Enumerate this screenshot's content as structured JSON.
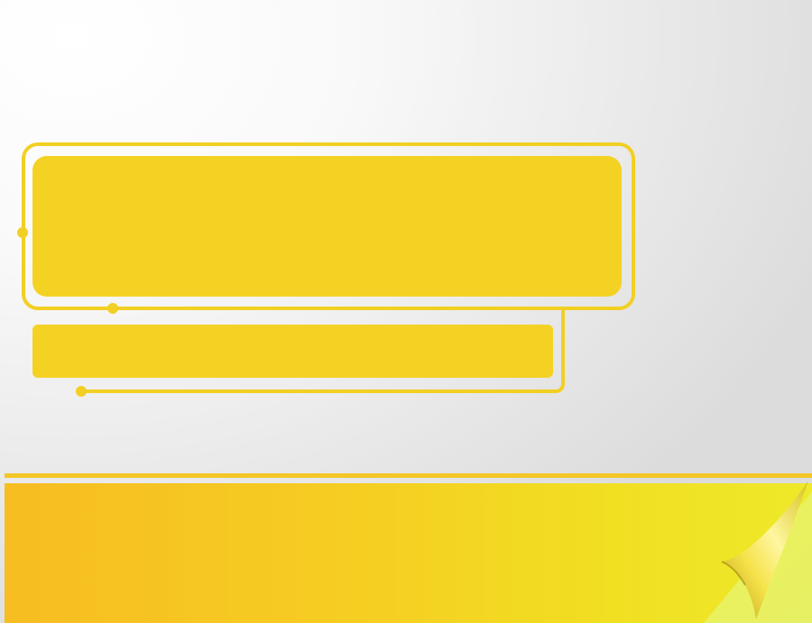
{
  "slide": {
    "title": "",
    "subtitle": "",
    "footer_text": ""
  },
  "colors": {
    "accent_yellow": "#f4d224",
    "outline_yellow": "#f2cf23",
    "band_left": "#f7bd22",
    "band_right": "#eee92a",
    "background": "#f3f3f3"
  },
  "icons": {
    "page_curl": "page-curl-icon"
  }
}
